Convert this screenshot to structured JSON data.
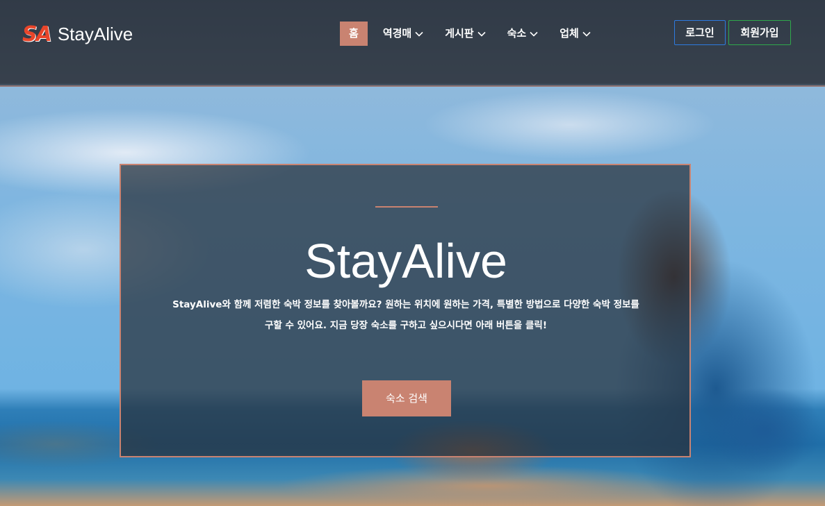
{
  "logo": {
    "mark": "SA",
    "name": "StayAlive"
  },
  "nav": {
    "items": [
      {
        "label": "홈",
        "active": true,
        "dropdown": false
      },
      {
        "label": "역경매",
        "active": false,
        "dropdown": true
      },
      {
        "label": "게시판",
        "active": false,
        "dropdown": true
      },
      {
        "label": "숙소",
        "active": false,
        "dropdown": true
      },
      {
        "label": "업체",
        "active": false,
        "dropdown": true
      }
    ]
  },
  "auth": {
    "login_label": "로그인",
    "signup_label": "회원가입"
  },
  "hero": {
    "title": "StayAlive",
    "description_line1": "StayAlive와 함께 저렴한 숙박 정보를 찾아볼까요? 원하는 위치에 원하는 가격, 특별한 방법으로 다양한 숙박 정보를",
    "description_line2": "구할 수 있어요. 지금 당장 숙소를 구하고 싶으시다면 아래 버튼을 클릭!",
    "search_button_label": "숙소 검색"
  },
  "colors": {
    "accent": "#c98371",
    "logo_red": "#e8452a",
    "login_border": "#2d7be0",
    "signup_border": "#2fa94b"
  },
  "icons": {
    "dropdown": "chevron-down-icon"
  }
}
